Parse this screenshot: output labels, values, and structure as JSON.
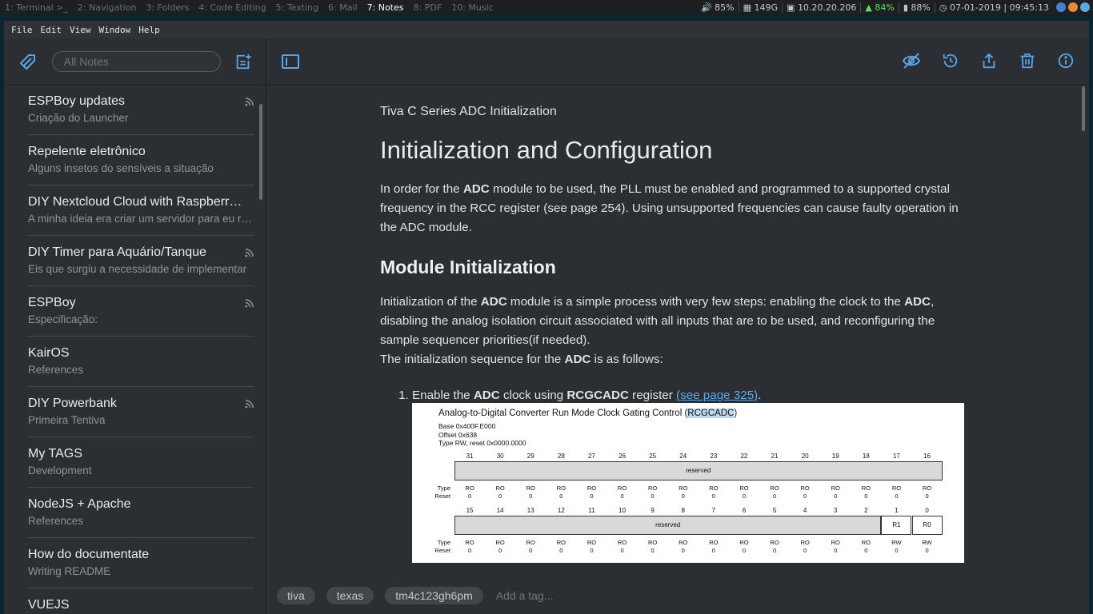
{
  "wm": {
    "workspaces": [
      "1: Terminal >_",
      "2: Navigation",
      "3: Folders",
      "4: Code Editing",
      "5: Texting",
      "6: Mail",
      "7: Notes",
      "8: PDF",
      "9: Music"
    ],
    "workspaces_extra": "10: Music",
    "active_index": 6,
    "volume": "85%",
    "disk": "149G",
    "ip": "10.20.20.206",
    "wifi": "84%",
    "battery": "88%",
    "datetime": "07-01-2019 | 09:45:13"
  },
  "menu": [
    "File",
    "Edit",
    "View",
    "Window",
    "Help"
  ],
  "sidebar": {
    "search_placeholder": "All Notes",
    "notes": [
      {
        "title": "ESPBoy updates",
        "subtitle": "Criação do Launcher",
        "rss": true
      },
      {
        "title": "Repelente eletrônico",
        "subtitle": "Alguns insetos do sensíveis a situação",
        "rss": false
      },
      {
        "title": "DIY Nextcloud Cloud with Raspberry Pi",
        "subtitle": "A minha ideia era criar um servidor para eu rodar",
        "rss": false
      },
      {
        "title": "DIY Timer para Aquário/Tanque",
        "subtitle": "Eis que surgiu a necessidade de implementar",
        "rss": true
      },
      {
        "title": "ESPBoy",
        "subtitle": "Especificação:",
        "rss": true
      },
      {
        "title": "KairOS",
        "subtitle": "References",
        "rss": false
      },
      {
        "title": "DIY Powerbank",
        "subtitle": "Primeira Tentiva",
        "rss": true
      },
      {
        "title": "My TAGS",
        "subtitle": "Development",
        "rss": false
      },
      {
        "title": "NodeJS + Apache",
        "subtitle": "References",
        "rss": false
      },
      {
        "title": "How do documentate",
        "subtitle": "Writing README",
        "rss": false
      },
      {
        "title": "VUEJS",
        "subtitle": "",
        "rss": false
      }
    ]
  },
  "note": {
    "title": "Tiva C Series ADC Initialization",
    "h1": "Initialization and Configuration",
    "p1_parts": [
      "In order for the ",
      "ADC",
      " module to be used, the PLL must be enabled and programmed to a supported crystal frequency in the RCC register (see page 254). Using unsupported frequencies can cause faulty operation in the ADC module."
    ],
    "h2": "Module Initialization",
    "p2_parts": [
      "Initialization of the ",
      "ADC",
      " module is a simple process with very few steps: enabling the clock to the ",
      "ADC",
      ", disabling the analog isolation circuit associated with all inputs that are to be used, and reconfiguring the sample sequencer priorities(if needed)."
    ],
    "p3_parts": [
      "The initialization sequence for the ",
      "ADC",
      " is as follows:"
    ],
    "step1_parts": [
      "Enable the ",
      "ADC",
      " clock using ",
      "RCGCADC",
      " register ",
      "(see page 325)",
      "."
    ]
  },
  "figure": {
    "title_pre": "Analog-to-Digital Converter Run Mode Clock Gating Control (",
    "title_hl": "RCGCADC",
    "title_post": ")",
    "base": "Base 0x400F.E000",
    "offset": "Offset 0x638",
    "type": "Type RW, reset 0x0000.0000",
    "bits_high": [
      "31",
      "30",
      "29",
      "28",
      "27",
      "26",
      "25",
      "24",
      "23",
      "22",
      "21",
      "20",
      "19",
      "18",
      "17",
      "16"
    ],
    "bits_low": [
      "15",
      "14",
      "13",
      "12",
      "11",
      "10",
      "9",
      "8",
      "7",
      "6",
      "5",
      "4",
      "3",
      "2",
      "1",
      "0"
    ],
    "reserved": "reserved",
    "r1": "R1",
    "r0": "R0",
    "type_label": "Type",
    "reset_label": "Reset",
    "ro": "RO",
    "rw": "RW",
    "zero": "0"
  },
  "tags": [
    "tiva",
    "texas",
    "tm4c123gh6pm"
  ],
  "add_tag_placeholder": "Add a tag..."
}
